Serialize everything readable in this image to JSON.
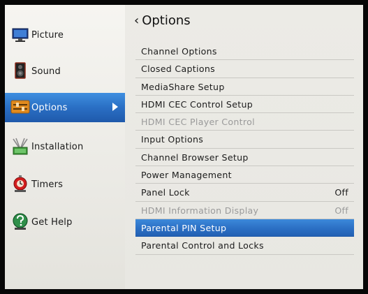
{
  "sidebar": {
    "items": [
      {
        "label": "Picture",
        "icon": "monitor-icon"
      },
      {
        "label": "Sound",
        "icon": "speaker-icon"
      },
      {
        "label": "Options",
        "icon": "sliders-icon",
        "selected": true
      },
      {
        "label": "Installation",
        "icon": "antenna-icon"
      },
      {
        "label": "Timers",
        "icon": "alarm-clock-icon"
      },
      {
        "label": "Get Help",
        "icon": "help-icon"
      }
    ]
  },
  "panel": {
    "back_chevron": "‹",
    "title": "Options",
    "items": [
      {
        "label": "Channel Options",
        "value": ""
      },
      {
        "label": "Closed Captions",
        "value": ""
      },
      {
        "label": "MediaShare Setup",
        "value": ""
      },
      {
        "label": "HDMI CEC Control Setup",
        "value": ""
      },
      {
        "label": "HDMI CEC Player Control",
        "value": "",
        "disabled": true
      },
      {
        "label": "Input Options",
        "value": ""
      },
      {
        "label": "Channel Browser Setup",
        "value": ""
      },
      {
        "label": "Power Management",
        "value": ""
      },
      {
        "label": "Panel Lock",
        "value": "Off"
      },
      {
        "label": "HDMI Information Display",
        "value": "Off",
        "disabled": true
      },
      {
        "label": "Parental PIN Setup",
        "value": "",
        "selected": true
      },
      {
        "label": "Parental Control and Locks",
        "value": ""
      }
    ]
  },
  "colors": {
    "accent": "#2a6fc4",
    "panel_bg": "#ecebe6",
    "disabled_text": "#9a9a9a",
    "bezel": "#070707"
  }
}
